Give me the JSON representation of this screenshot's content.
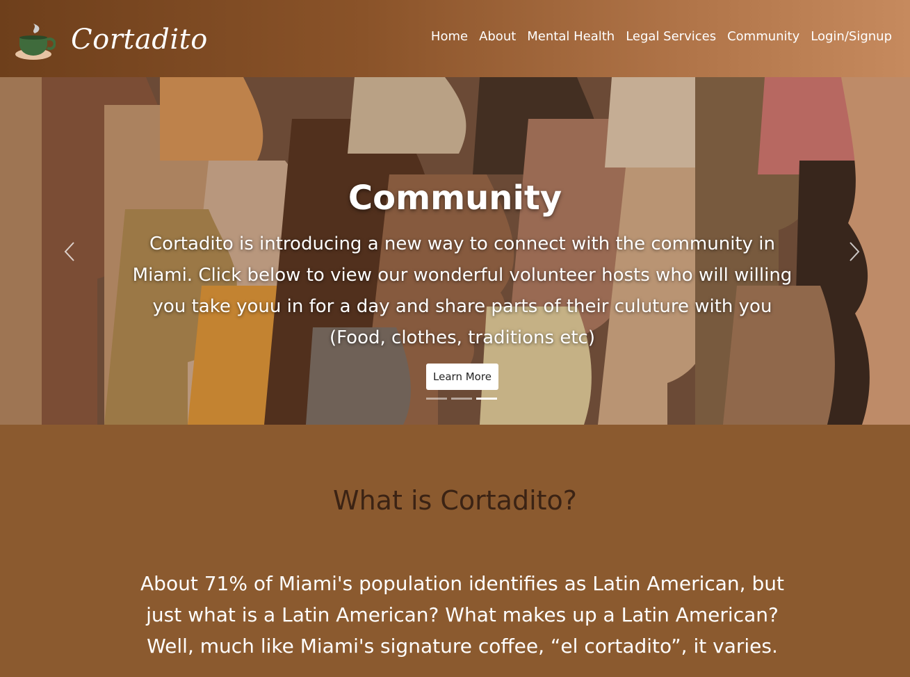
{
  "brand": {
    "name": "Cortadito",
    "logo_icon": "coffee-cup-icon"
  },
  "nav": {
    "items": [
      "Home",
      "About",
      "Mental Health",
      "Legal Services",
      "Community",
      "Login/Signup"
    ]
  },
  "hero": {
    "title": "Community",
    "text": "Cortadito is introducing a new way to connect with the community in Miami. Click below to view our wonderful volunteer hosts who will willing you take youu in for a day and share parts of their culuture with you (Food, clothes, traditions etc)",
    "button_label": "Learn More",
    "slide_count": 3,
    "active_slide": 3
  },
  "about": {
    "title": "What is Cortadito?",
    "text": "About 71% of Miami's population identifies as Latin American, but  just what is a Latin American? What makes up a Latin American? Well, much like Miami's signature coffee, “el cortadito”, it varies."
  },
  "colors": {
    "header_start": "#6e3f1b",
    "header_end": "#c68a5e",
    "section_bg": "#8b5a2f",
    "about_title": "#3b2314"
  }
}
